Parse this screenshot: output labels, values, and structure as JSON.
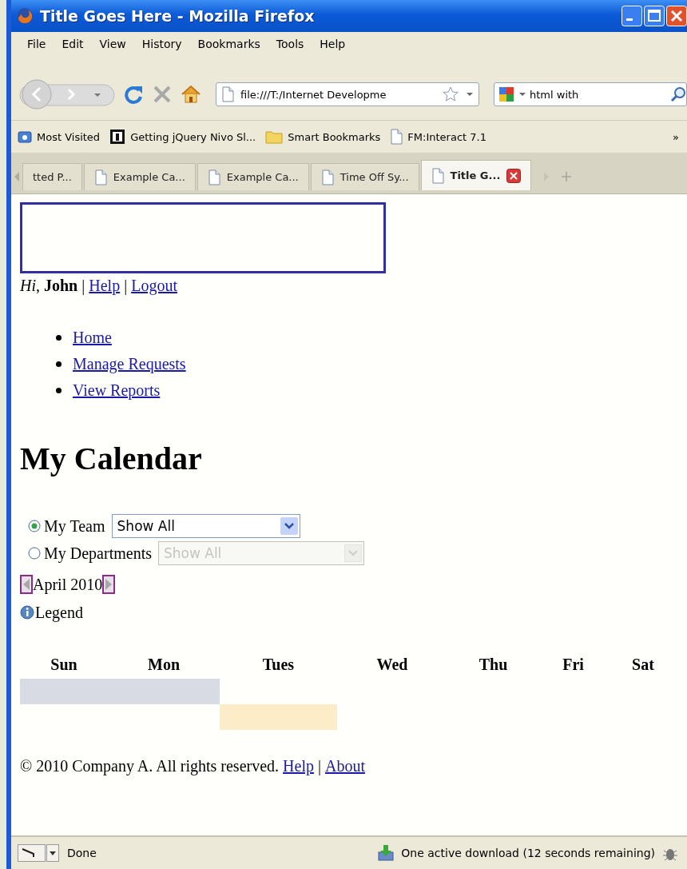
{
  "window": {
    "title": "Title Goes Here - Mozilla Firefox"
  },
  "menu": [
    "File",
    "Edit",
    "View",
    "History",
    "Bookmarks",
    "Tools",
    "Help"
  ],
  "navigation": {
    "address": "file:///T:/Internet Developme",
    "search": "html with"
  },
  "bookmarks": [
    {
      "label": "Most Visited",
      "kind": "smart"
    },
    {
      "label": "Getting jQuery Nivo Sl...",
      "kind": "site"
    },
    {
      "label": "Smart Bookmarks",
      "kind": "folder"
    },
    {
      "label": "FM:Interact 7.1",
      "kind": "page"
    }
  ],
  "bookmarks_overflow": "»",
  "tabs": [
    {
      "label": "tted P...",
      "selected": false
    },
    {
      "label": "Example Ca...",
      "selected": false
    },
    {
      "label": "Example Ca...",
      "selected": false
    },
    {
      "label": "Time Off Sy...",
      "selected": false
    },
    {
      "label": "Title G...",
      "selected": true
    }
  ],
  "page": {
    "user_bar": [
      {
        "kind": "text",
        "text": "*Hi*, **John**"
      },
      {
        "kind": "separator",
        "text": "|"
      },
      {
        "kind": "link",
        "text": "Help"
      },
      {
        "kind": "separator",
        "text": "|"
      },
      {
        "kind": "link",
        "text": "Logout"
      }
    ],
    "nav_links": [
      "Home",
      "Manage Requests",
      "View Reports"
    ],
    "heading": "My Calendar",
    "filters": [
      {
        "label": "My Team",
        "selected": true,
        "dropdown": {
          "value": "Show All",
          "disabled": false
        }
      },
      {
        "label": "My Departments",
        "selected": false,
        "dropdown": {
          "value": "Show All",
          "disabled": true
        }
      }
    ],
    "month": "April 2010",
    "legend": "Legend",
    "calendar": {
      "days": [
        "Sun",
        "Mon",
        "Tues",
        "Wed",
        "Thu",
        "Fri",
        "Sat"
      ],
      "events": [
        {
          "color": "#d9dbe4",
          "cells": [
            {
              "kind": "event"
            },
            {
              "kind": "event"
            },
            {
              "kind": "empty"
            },
            {
              "kind": "empty"
            },
            {
              "kind": "empty"
            },
            {
              "kind": "empty"
            },
            {
              "kind": "empty"
            }
          ]
        },
        {
          "color": "#fdecc8",
          "cells": [
            {
              "kind": "empty"
            },
            {
              "kind": "empty"
            },
            {
              "kind": "event"
            },
            {
              "kind": "empty"
            },
            {
              "kind": "empty"
            },
            {
              "kind": "empty"
            },
            {
              "kind": "empty"
            }
          ]
        }
      ]
    },
    "footer": [
      {
        "kind": "text",
        "text": "© 2010 Company A.  All rights reserved."
      },
      {
        "kind": "link",
        "text": "Help"
      },
      {
        "kind": "separator",
        "text": "|"
      },
      {
        "kind": "link",
        "text": "About"
      }
    ]
  },
  "status_bar": {
    "status": "Done",
    "download": "One active download (12 seconds remaining)"
  }
}
